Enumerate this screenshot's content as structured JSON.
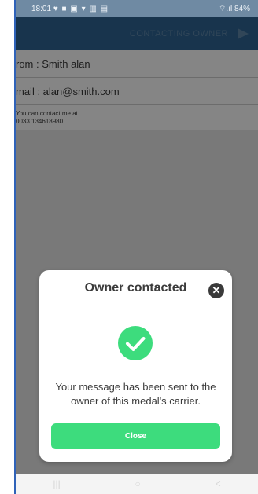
{
  "status": {
    "time": "18:01",
    "left_icons": "♥ ■ ▣ ▾ ▥ ▤",
    "right": "⌔.ıl 84%"
  },
  "appbar": {
    "title": "CONTACTING OWNER"
  },
  "form": {
    "from": "rom : Smith alan",
    "email": "mail : alan@smith.com",
    "message": "You can contact me at\n0033 134618980"
  },
  "dialog": {
    "title": "Owner contacted",
    "message": "Your message has been sent to the owner of this medal's carrier.",
    "close_label": "Close"
  },
  "navbar": {
    "recent": "|||",
    "home": "○",
    "back": "<"
  },
  "colors": {
    "accent": "#3ddc7d",
    "appbar": "#2e6595"
  }
}
